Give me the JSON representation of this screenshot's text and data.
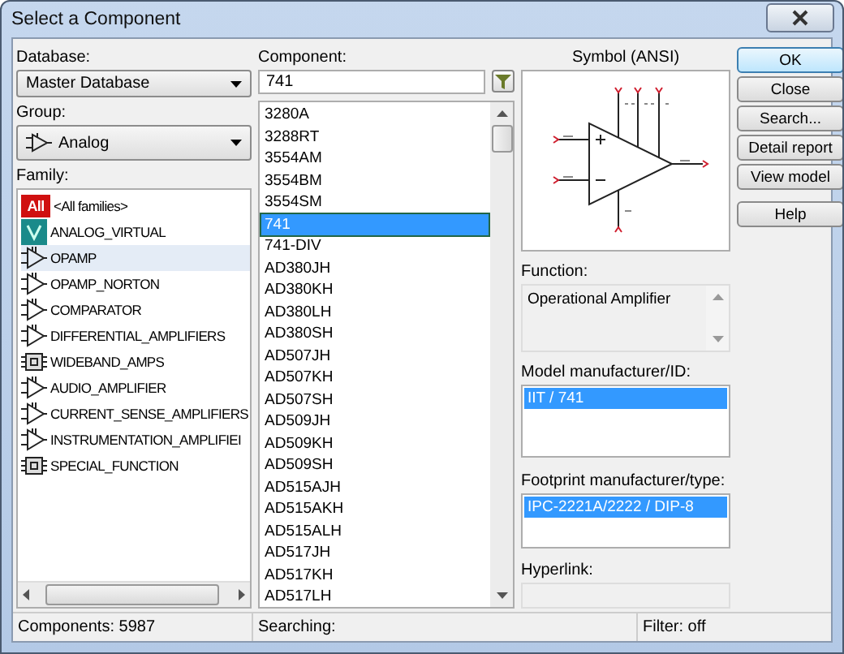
{
  "window": {
    "title": "Select a Component"
  },
  "database": {
    "label": "Database:",
    "value": "Master Database"
  },
  "group": {
    "label": "Group:",
    "value": "Analog"
  },
  "family": {
    "label": "Family:",
    "items": [
      {
        "name": "<All families>",
        "kind": "all",
        "badge": "All",
        "selected": false
      },
      {
        "name": "ANALOG_VIRTUAL",
        "kind": "virtual",
        "selected": false
      },
      {
        "name": "OPAMP",
        "kind": "amp",
        "selected": true
      },
      {
        "name": "OPAMP_NORTON",
        "kind": "amp",
        "selected": false
      },
      {
        "name": "COMPARATOR",
        "kind": "amp",
        "selected": false
      },
      {
        "name": "DIFFERENTIAL_AMPLIFIERS",
        "kind": "amp",
        "selected": false
      },
      {
        "name": "WIDEBAND_AMPS",
        "kind": "chip",
        "selected": false
      },
      {
        "name": "AUDIO_AMPLIFIER",
        "kind": "amp",
        "selected": false
      },
      {
        "name": "CURRENT_SENSE_AMPLIFIERS",
        "kind": "amp",
        "selected": false
      },
      {
        "name": "INSTRUMENTATION_AMPLIFIEI",
        "kind": "amp",
        "selected": false
      },
      {
        "name": "SPECIAL_FUNCTION",
        "kind": "chip",
        "selected": false
      }
    ]
  },
  "component": {
    "label": "Component:",
    "value": "741",
    "items": [
      {
        "name": "3280A",
        "selected": false
      },
      {
        "name": "3288RT",
        "selected": false
      },
      {
        "name": "3554AM",
        "selected": false
      },
      {
        "name": "3554BM",
        "selected": false
      },
      {
        "name": "3554SM",
        "selected": false
      },
      {
        "name": "741",
        "selected": true
      },
      {
        "name": "741-DIV",
        "selected": false
      },
      {
        "name": "AD380JH",
        "selected": false
      },
      {
        "name": "AD380KH",
        "selected": false
      },
      {
        "name": "AD380LH",
        "selected": false
      },
      {
        "name": "AD380SH",
        "selected": false
      },
      {
        "name": "AD507JH",
        "selected": false
      },
      {
        "name": "AD507KH",
        "selected": false
      },
      {
        "name": "AD507SH",
        "selected": false
      },
      {
        "name": "AD509JH",
        "selected": false
      },
      {
        "name": "AD509KH",
        "selected": false
      },
      {
        "name": "AD509SH",
        "selected": false
      },
      {
        "name": "AD515AJH",
        "selected": false
      },
      {
        "name": "AD515AKH",
        "selected": false
      },
      {
        "name": "AD515ALH",
        "selected": false
      },
      {
        "name": "AD517JH",
        "selected": false
      },
      {
        "name": "AD517KH",
        "selected": false
      },
      {
        "name": "AD517LH",
        "selected": false
      }
    ]
  },
  "symbol": {
    "title": "Symbol (ANSI)"
  },
  "function": {
    "label": "Function:",
    "value": "Operational Amplifier"
  },
  "model": {
    "label": "Model manufacturer/ID:",
    "items": [
      {
        "name": "IIT / 741",
        "selected": true
      }
    ]
  },
  "footprint": {
    "label": "Footprint manufacturer/type:",
    "items": [
      {
        "name": "IPC-2221A/2222 / DIP-8",
        "selected": true
      }
    ]
  },
  "hyperlink": {
    "label": "Hyperlink:"
  },
  "buttons": [
    {
      "label": "OK",
      "default": true
    },
    {
      "label": "Close",
      "default": false
    },
    {
      "label": "Search...",
      "default": false
    },
    {
      "label": "Detail report",
      "default": false
    },
    {
      "label": "View model",
      "default": false
    },
    {
      "label": "Help",
      "default": false
    }
  ],
  "status_bar": {
    "components": "Components: 5987",
    "searching": "Searching:",
    "filter": "Filter: off"
  }
}
